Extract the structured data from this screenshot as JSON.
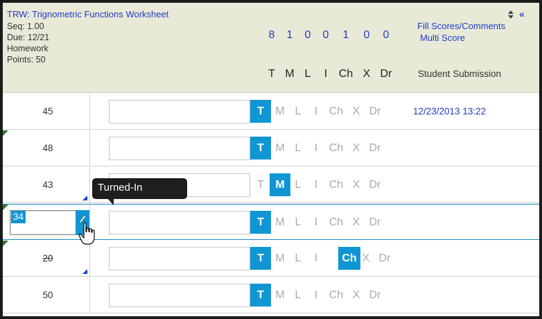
{
  "header": {
    "title": "TRW: Trignometric Functions Worksheet",
    "seq": "Seq: 1.00",
    "due": "Due: 12/21",
    "category": "Homework",
    "points": "Points: 50",
    "fill_link": "Fill Scores/Comments",
    "multi_link": "Multi Score",
    "submission_label": "Student Submission",
    "collapse_icon": "«",
    "counts": [
      "8",
      "1",
      "0",
      "0",
      "1",
      "0",
      "0"
    ],
    "codes": [
      "T",
      "M",
      "L",
      "I",
      "Ch",
      "X",
      "Dr"
    ]
  },
  "rows": [
    {
      "score": "45",
      "active_code": "T",
      "timestamp": "12/23/2013 13:22"
    },
    {
      "score": "48",
      "active_code": "T",
      "timestamp": ""
    },
    {
      "score": "43",
      "active_code": "M",
      "timestamp": ""
    },
    {
      "score": "34",
      "active_code": "T",
      "timestamp": "",
      "editing": true
    },
    {
      "score": "20",
      "active_code": "Ch",
      "timestamp": ""
    },
    {
      "score": "50",
      "active_code": "T",
      "timestamp": ""
    }
  ],
  "tooltip": {
    "text": "Turned-In"
  },
  "colors": {
    "accent": "#1196d4",
    "link": "#1f3cc4",
    "header_bg": "#e9e9d8"
  }
}
